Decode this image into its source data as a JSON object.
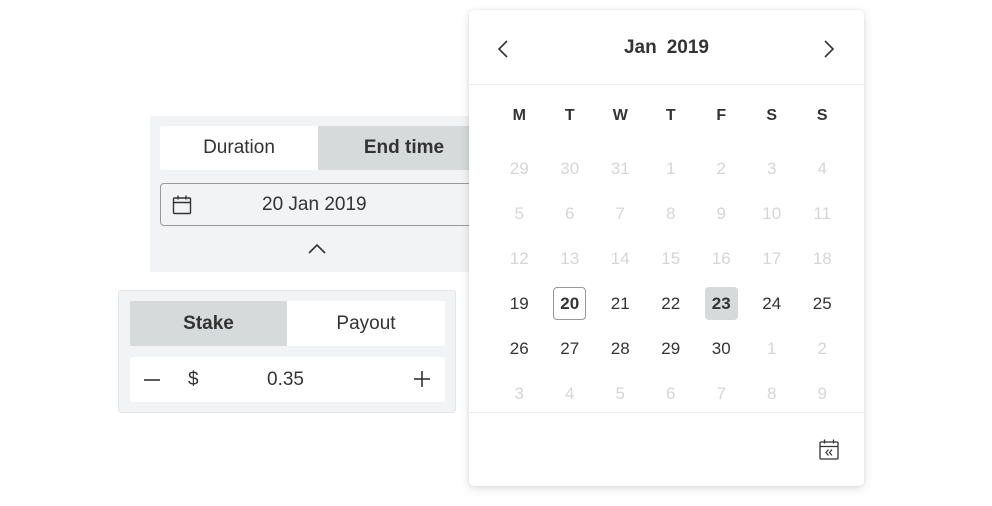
{
  "trade_params": {
    "duration_tabs": [
      {
        "label": "Duration",
        "active": false
      },
      {
        "label": "End time",
        "active": true
      }
    ],
    "end_date": "20 Jan 2019",
    "amount_tabs": [
      {
        "label": "Stake",
        "active": true
      },
      {
        "label": "Payout",
        "active": false
      }
    ],
    "currency": "$",
    "amount": "0.35"
  },
  "calendar": {
    "month": "Jan",
    "year": "2019",
    "weekdays": [
      "M",
      "T",
      "W",
      "T",
      "F",
      "S",
      "S"
    ],
    "weeks": [
      [
        {
          "d": "29",
          "o": true
        },
        {
          "d": "30",
          "o": true
        },
        {
          "d": "31",
          "o": true
        },
        {
          "d": "1",
          "o": true
        },
        {
          "d": "2",
          "o": true
        },
        {
          "d": "3",
          "o": true
        },
        {
          "d": "4",
          "o": true
        }
      ],
      [
        {
          "d": "5",
          "o": true
        },
        {
          "d": "6",
          "o": true
        },
        {
          "d": "7",
          "o": true
        },
        {
          "d": "8",
          "o": true
        },
        {
          "d": "9",
          "o": true
        },
        {
          "d": "10",
          "o": true
        },
        {
          "d": "11",
          "o": true
        }
      ],
      [
        {
          "d": "12",
          "o": true
        },
        {
          "d": "13",
          "o": true
        },
        {
          "d": "14",
          "o": true
        },
        {
          "d": "15",
          "o": true
        },
        {
          "d": "16",
          "o": true
        },
        {
          "d": "17",
          "o": true
        },
        {
          "d": "18",
          "o": true
        }
      ],
      [
        {
          "d": "19"
        },
        {
          "d": "20",
          "today": true
        },
        {
          "d": "21"
        },
        {
          "d": "22"
        },
        {
          "d": "23",
          "selected": true
        },
        {
          "d": "24"
        },
        {
          "d": "25"
        }
      ],
      [
        {
          "d": "26"
        },
        {
          "d": "27"
        },
        {
          "d": "28"
        },
        {
          "d": "29"
        },
        {
          "d": "30"
        },
        {
          "d": "1",
          "o": true
        },
        {
          "d": "2",
          "o": true
        }
      ],
      [
        {
          "d": "3",
          "o": true
        },
        {
          "d": "4",
          "o": true
        },
        {
          "d": "5",
          "o": true
        },
        {
          "d": "6",
          "o": true
        },
        {
          "d": "7",
          "o": true
        },
        {
          "d": "8",
          "o": true
        },
        {
          "d": "9",
          "o": true
        }
      ]
    ]
  },
  "icons": {
    "calendar": "calendar-icon",
    "collapse": "chevron-up-icon",
    "prev": "chevron-left-icon",
    "next": "chevron-right-icon",
    "decrement": "minus-icon",
    "increment": "plus-icon",
    "go_to_today": "calendar-today-icon"
  },
  "colors": {
    "panel_bg": "#f2f3f4",
    "active_tab": "#d6dadb",
    "text": "#333333",
    "disabled_text": "#d6d6d6"
  }
}
